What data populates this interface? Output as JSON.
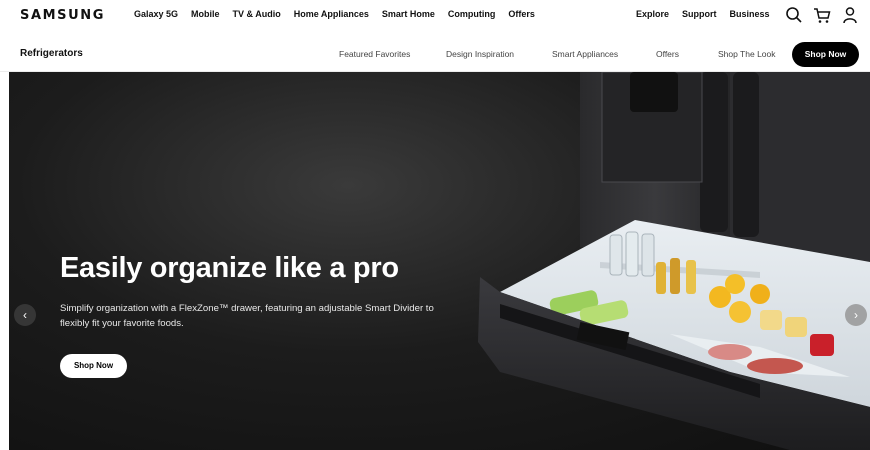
{
  "brand": {
    "logo": "SAMSUNG"
  },
  "top_nav": {
    "main_links": [
      "Galaxy 5G",
      "Mobile",
      "TV & Audio",
      "Home Appliances",
      "Smart Home",
      "Computing",
      "Offers"
    ],
    "right_links": [
      "Explore",
      "Support",
      "Business"
    ],
    "icons": [
      "search-icon",
      "cart-icon",
      "user-icon"
    ]
  },
  "sub_nav": {
    "title": "Refrigerators",
    "links": [
      "Featured Favorites",
      "Design Inspiration",
      "Smart Appliances",
      "Offers",
      "Shop The Look"
    ],
    "cta": "Shop Now"
  },
  "hero": {
    "title": "Easily organize like a pro",
    "description": "Simplify organization with a FlexZone™ drawer, featuring an adjustable Smart Divider to flexibly fit your favorite foods.",
    "cta": "Shop Now",
    "prev_arrow": "‹",
    "next_arrow": "›"
  },
  "colors": {
    "cta_dark": "#000000",
    "hero_bg": "#1a1a1a",
    "text_light": "#ffffff"
  }
}
